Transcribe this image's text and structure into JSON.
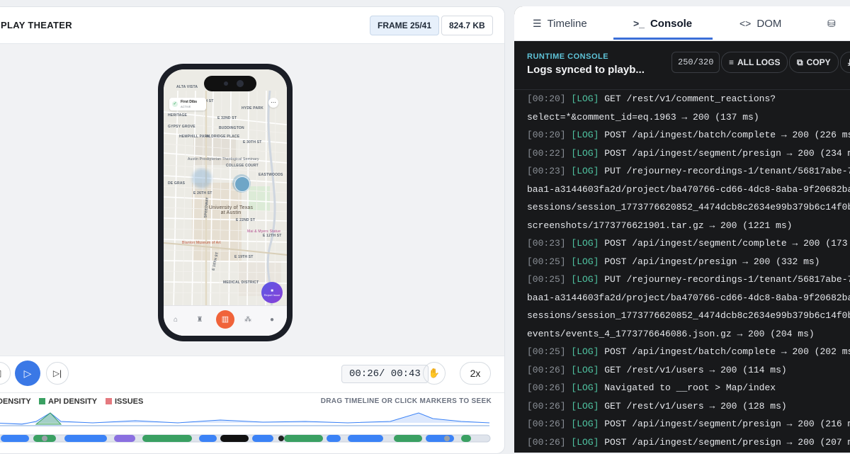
{
  "left": {
    "title": "PLAY THEATER",
    "frame_badge": "FRAME 25/41",
    "size_badge": "824.7 KB",
    "phone": {
      "card_title": "First Dibs",
      "card_sub": "ACTIVE",
      "map_labels": [
        "ALTA VISTA",
        "HYDE PARK",
        "HERITAGE",
        "GYPSY GROVE",
        "BUDDINGTON",
        "HEMPHILL PARK",
        "ALDRIDGE PLACE",
        "Austin Presbyterian Theological Seminary",
        "COLLEGE COURT",
        "EASTWOODS",
        "DE GRAS",
        "E 26TH ST",
        "University of Texas at Austin",
        "Mai & Myers Statue",
        "Blanton Museum of Art",
        "MEDICAL DISTRICT",
        "E 15TH ST",
        "E 19TH ST",
        "E 12TH ST",
        "SPEEDWAY",
        "E 38TH ST",
        "E 32ND ST",
        "E 30TH ST",
        "E 22ND ST"
      ],
      "report_label": "Report Issue"
    },
    "time_display": "00:26/ 00:43",
    "speed": "2x",
    "legend": [
      {
        "label": "DENSITY",
        "color": "#3b82f6"
      },
      {
        "label": "API DENSITY",
        "color": "#3aa062"
      },
      {
        "label": "ISSUES",
        "color": "#e4797f"
      }
    ],
    "legend_hint": "DRAG TIMELINE OR CLICK MARKERS TO SEEK"
  },
  "right": {
    "tabs": [
      {
        "label": "Timeline",
        "icon": "list-icon"
      },
      {
        "label": "Console",
        "icon": "terminal-icon",
        "active": true
      },
      {
        "label": "DOM",
        "icon": "code-icon"
      },
      {
        "label": "",
        "icon": "database-icon"
      }
    ],
    "console_label": "RUNTIME CONSOLE",
    "console_title": "Logs synced to playb...",
    "count": "250/320",
    "all_logs": "ALL LOGS",
    "copy": "COPY",
    "logs": [
      {
        "ts": "[00:20]",
        "tag": "[LOG]",
        "msg": " GET /rest/v1/comment_reactions?"
      },
      {
        "ts": "",
        "tag": "",
        "msg": "select=*&comment_id=eq.1963 → 200 (137 ms)"
      },
      {
        "ts": "[00:20]",
        "tag": "[LOG]",
        "msg": " POST /api/ingest/batch/complete → 200 (226 ms"
      },
      {
        "ts": "[00:22]",
        "tag": "[LOG]",
        "msg": " POST /api/ingest/segment/presign → 200 (234 m"
      },
      {
        "ts": "[00:23]",
        "tag": "[LOG]",
        "msg": " PUT /rejourney-recordings-1/tenant/56817abe-77"
      },
      {
        "ts": "",
        "tag": "",
        "msg": "baa1-a3144603fa2d/project/ba470766-cd66-4dc8-8aba-9f20682ba7"
      },
      {
        "ts": "",
        "tag": "",
        "msg": "sessions/session_1773776620852_4474dcb8c2634e99b379b6c14f0b6"
      },
      {
        "ts": "",
        "tag": "",
        "msg": "screenshots/1773776621901.tar.gz → 200 (1221 ms)"
      },
      {
        "ts": "[00:23]",
        "tag": "[LOG]",
        "msg": " POST /api/ingest/segment/complete → 200 (173 "
      },
      {
        "ts": "[00:25]",
        "tag": "[LOG]",
        "msg": " POST /api/ingest/presign → 200 (332 ms)"
      },
      {
        "ts": "[00:25]",
        "tag": "[LOG]",
        "msg": " PUT /rejourney-recordings-1/tenant/56817abe-77"
      },
      {
        "ts": "",
        "tag": "",
        "msg": "baa1-a3144603fa2d/project/ba470766-cd66-4dc8-8aba-9f20682ba7"
      },
      {
        "ts": "",
        "tag": "",
        "msg": "sessions/session_1773776620852_4474dcb8c2634e99b379b6c14f0b6"
      },
      {
        "ts": "",
        "tag": "",
        "msg": "events/events_4_1773776646086.json.gz → 200 (204 ms)"
      },
      {
        "ts": "[00:25]",
        "tag": "[LOG]",
        "msg": " POST /api/ingest/batch/complete → 200 (202 ms"
      },
      {
        "ts": "[00:26]",
        "tag": "[LOG]",
        "msg": " GET /rest/v1/users → 200 (114 ms)"
      },
      {
        "ts": "[00:26]",
        "tag": "[LOG]",
        "msg": " Navigated to __root > Map/index"
      },
      {
        "ts": "[00:26]",
        "tag": "[LOG]",
        "msg": " GET /rest/v1/users → 200 (128 ms)"
      },
      {
        "ts": "[00:26]",
        "tag": "[LOG]",
        "msg": " POST /api/ingest/segment/presign → 200 (216 m"
      },
      {
        "ts": "[00:26]",
        "tag": "[LOG]",
        "msg": " POST /api/ingest/segment/presign → 200 (207 m"
      }
    ]
  }
}
